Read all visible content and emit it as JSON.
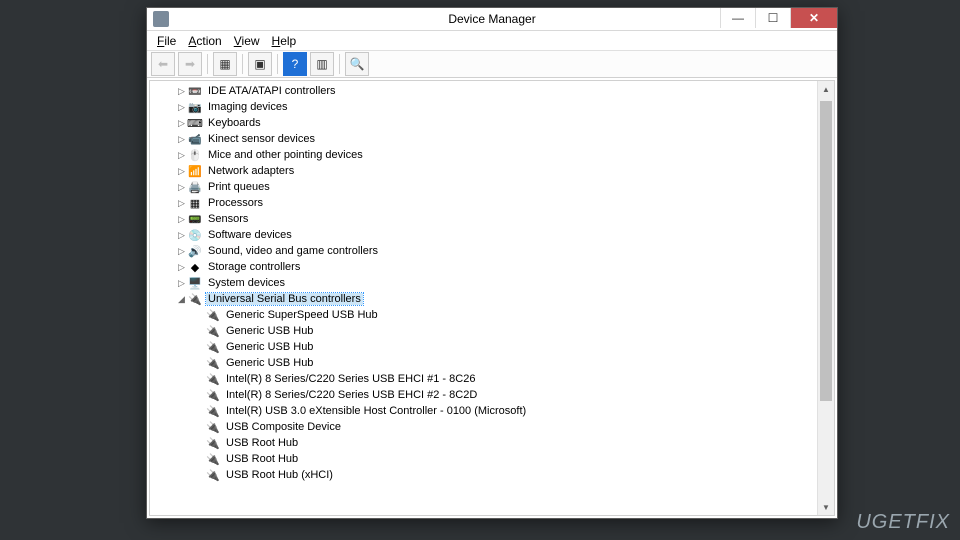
{
  "window": {
    "title": "Device Manager"
  },
  "menu": {
    "file": "File",
    "action": "Action",
    "view": "View",
    "help": "Help"
  },
  "watermark": "UGETFIX",
  "tree": {
    "collapsed": [
      {
        "label": "IDE ATA/ATAPI controllers",
        "icon": "📼",
        "name": "ide-atapi"
      },
      {
        "label": "Imaging devices",
        "icon": "📷",
        "name": "imaging"
      },
      {
        "label": "Keyboards",
        "icon": "⌨",
        "name": "keyboards"
      },
      {
        "label": "Kinect sensor devices",
        "icon": "📹",
        "name": "kinect"
      },
      {
        "label": "Mice and other pointing devices",
        "icon": "🖱️",
        "name": "mice"
      },
      {
        "label": "Network adapters",
        "icon": "📶",
        "name": "network"
      },
      {
        "label": "Print queues",
        "icon": "🖨️",
        "name": "print"
      },
      {
        "label": "Processors",
        "icon": "▦",
        "name": "processors"
      },
      {
        "label": "Sensors",
        "icon": "📟",
        "name": "sensors"
      },
      {
        "label": "Software devices",
        "icon": "💿",
        "name": "software"
      },
      {
        "label": "Sound, video and game controllers",
        "icon": "🔊",
        "name": "sound"
      },
      {
        "label": "Storage controllers",
        "icon": "◆",
        "name": "storage"
      },
      {
        "label": "System devices",
        "icon": "🖥️",
        "name": "system"
      }
    ],
    "expanded": {
      "label": "Universal Serial Bus controllers",
      "icon": "🔌",
      "name": "usb-controllers",
      "children": [
        {
          "label": "Generic SuperSpeed USB Hub"
        },
        {
          "label": "Generic USB Hub"
        },
        {
          "label": "Generic USB Hub"
        },
        {
          "label": "Generic USB Hub"
        },
        {
          "label": "Intel(R) 8 Series/C220 Series USB EHCI #1 - 8C26"
        },
        {
          "label": "Intel(R) 8 Series/C220 Series USB EHCI #2 - 8C2D"
        },
        {
          "label": "Intel(R) USB 3.0 eXtensible Host Controller - 0100 (Microsoft)"
        },
        {
          "label": "USB Composite Device"
        },
        {
          "label": "USB Root Hub"
        },
        {
          "label": "USB Root Hub"
        },
        {
          "label": "USB Root Hub (xHCI)"
        }
      ]
    }
  }
}
